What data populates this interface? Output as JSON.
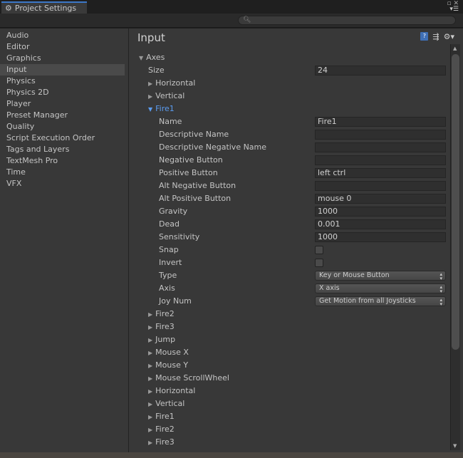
{
  "window": {
    "tab_title": "Project Settings",
    "search_placeholder": ""
  },
  "sidebar": {
    "items": [
      "Audio",
      "Editor",
      "Graphics",
      "Input",
      "Physics",
      "Physics 2D",
      "Player",
      "Preset Manager",
      "Quality",
      "Script Execution Order",
      "Tags and Layers",
      "TextMesh Pro",
      "Time",
      "VFX"
    ],
    "selected": "Input"
  },
  "main": {
    "title": "Input",
    "rows": [
      {
        "label": "Axes",
        "indent": 0,
        "kind": "foldout",
        "open": true
      },
      {
        "label": "Size",
        "indent": 1,
        "kind": "field",
        "value": "24"
      },
      {
        "label": "Horizontal",
        "indent": 1,
        "kind": "foldout"
      },
      {
        "label": "Vertical",
        "indent": 1,
        "kind": "foldout"
      },
      {
        "label": "Fire1",
        "indent": 1,
        "kind": "foldout",
        "open": true
      },
      {
        "label": "Name",
        "indent": 2,
        "kind": "field",
        "value": "Fire1"
      },
      {
        "label": "Descriptive Name",
        "indent": 2,
        "kind": "field",
        "value": ""
      },
      {
        "label": "Descriptive Negative Name",
        "indent": 2,
        "kind": "field",
        "value": ""
      },
      {
        "label": "Negative Button",
        "indent": 2,
        "kind": "field",
        "value": ""
      },
      {
        "label": "Positive Button",
        "indent": 2,
        "kind": "field",
        "value": "left ctrl"
      },
      {
        "label": "Alt Negative Button",
        "indent": 2,
        "kind": "field",
        "value": ""
      },
      {
        "label": "Alt Positive Button",
        "indent": 2,
        "kind": "field",
        "value": "mouse 0"
      },
      {
        "label": "Gravity",
        "indent": 2,
        "kind": "field",
        "value": "1000"
      },
      {
        "label": "Dead",
        "indent": 2,
        "kind": "field",
        "value": "0.001"
      },
      {
        "label": "Sensitivity",
        "indent": 2,
        "kind": "field",
        "value": "1000"
      },
      {
        "label": "Snap",
        "indent": 2,
        "kind": "checkbox",
        "checked": false
      },
      {
        "label": "Invert",
        "indent": 2,
        "kind": "checkbox",
        "checked": false
      },
      {
        "label": "Type",
        "indent": 2,
        "kind": "dropdown",
        "value": "Key or Mouse Button"
      },
      {
        "label": "Axis",
        "indent": 2,
        "kind": "dropdown",
        "value": "X axis"
      },
      {
        "label": "Joy Num",
        "indent": 2,
        "kind": "dropdown",
        "value": "Get Motion from all Joysticks"
      },
      {
        "label": "Fire2",
        "indent": 1,
        "kind": "foldout"
      },
      {
        "label": "Fire3",
        "indent": 1,
        "kind": "foldout"
      },
      {
        "label": "Jump",
        "indent": 1,
        "kind": "foldout"
      },
      {
        "label": "Mouse X",
        "indent": 1,
        "kind": "foldout"
      },
      {
        "label": "Mouse Y",
        "indent": 1,
        "kind": "foldout"
      },
      {
        "label": "Mouse ScrollWheel",
        "indent": 1,
        "kind": "foldout"
      },
      {
        "label": "Horizontal",
        "indent": 1,
        "kind": "foldout"
      },
      {
        "label": "Vertical",
        "indent": 1,
        "kind": "foldout"
      },
      {
        "label": "Fire1",
        "indent": 1,
        "kind": "foldout"
      },
      {
        "label": "Fire2",
        "indent": 1,
        "kind": "foldout"
      },
      {
        "label": "Fire3",
        "indent": 1,
        "kind": "foldout"
      }
    ]
  },
  "colors": {
    "accent": "#3c78c8",
    "foldout_open": "#5b9cf0",
    "panel": "#383838"
  }
}
